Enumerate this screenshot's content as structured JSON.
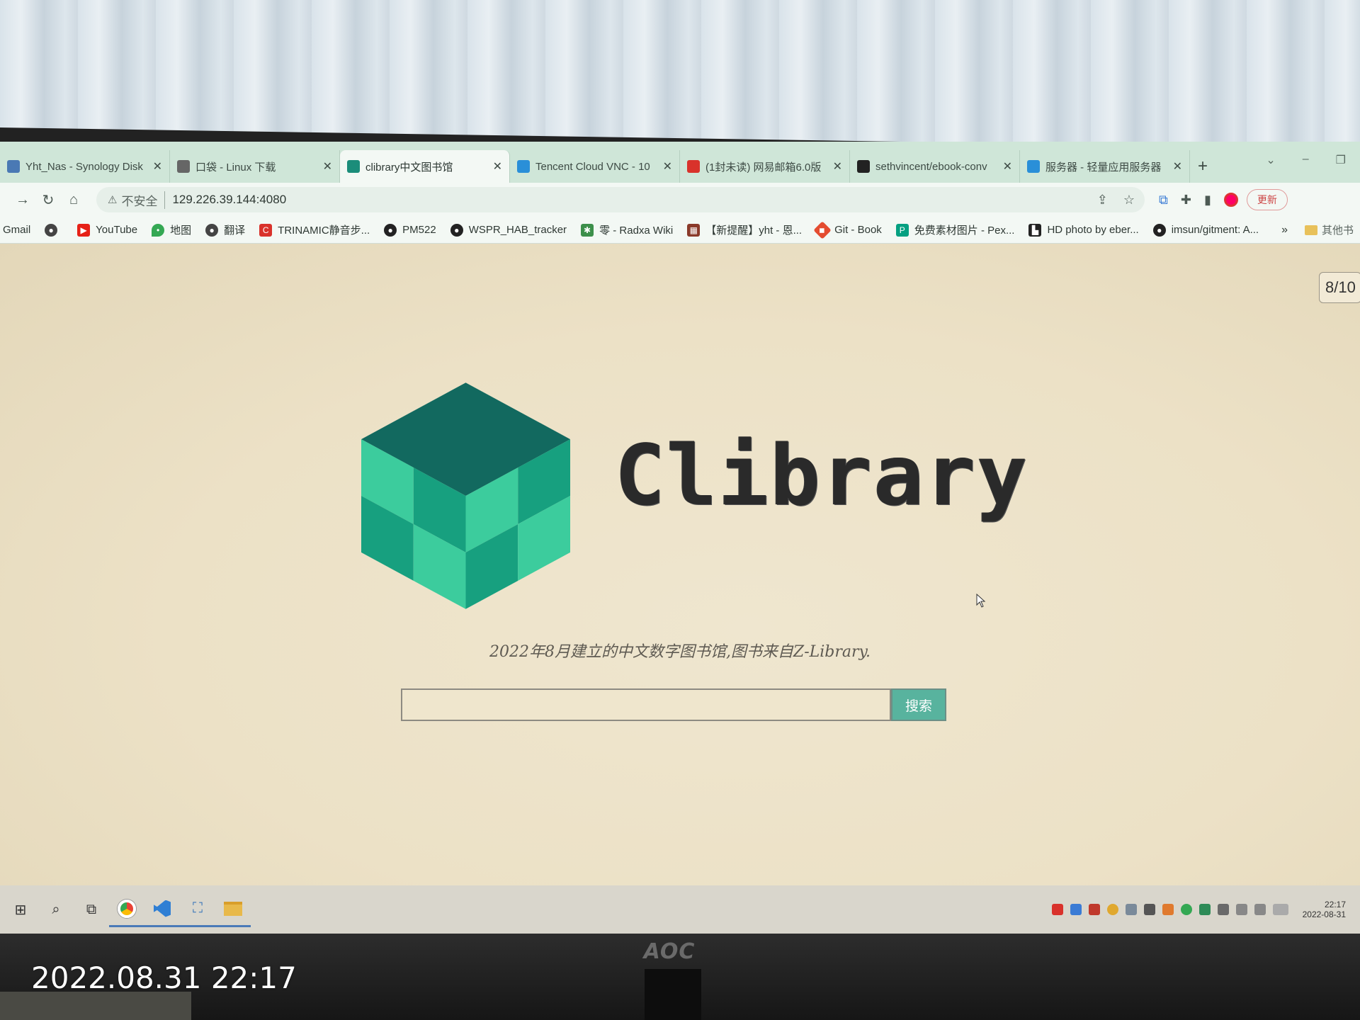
{
  "photo": {
    "timestamp": "2022.08.31 22:17",
    "monitor_brand": "AOC"
  },
  "browser": {
    "tabs": [
      {
        "label": "Yht_Nas - Synology Disk",
        "favicon": "synology-icon",
        "color": "#4a79b4"
      },
      {
        "label": "口袋 - Linux 下载",
        "favicon": "book-icon",
        "color": "#666666"
      },
      {
        "label": "clibrary中文图书馆",
        "favicon": "cube-icon",
        "color": "#1b8d7a",
        "active": true
      },
      {
        "label": "Tencent Cloud VNC - 10",
        "favicon": "cloud-icon",
        "color": "#2a8fd8"
      },
      {
        "label": "(1封未读) 网易邮箱6.0版",
        "favicon": "mail-icon",
        "color": "#d9322b"
      },
      {
        "label": "sethvincent/ebook-conv",
        "favicon": "github-icon",
        "color": "#222222"
      },
      {
        "label": "服务器 - 轻量应用服务器",
        "favicon": "cloud-icon",
        "color": "#2a8fd8"
      }
    ],
    "new_tab": "+",
    "address": {
      "security_label": "不安全",
      "url": "129.226.39.144:4080"
    },
    "update_label": "更新",
    "bookmarks": [
      {
        "label": "Gmail",
        "icon": "gmail-icon",
        "color": "transparent"
      },
      {
        "label": "",
        "icon": "globe-icon",
        "color": "#444444"
      },
      {
        "label": "YouTube",
        "icon": "youtube-icon",
        "color": "#e62117"
      },
      {
        "label": "地图",
        "icon": "maps-icon",
        "color": "#34a853"
      },
      {
        "label": "翻译",
        "icon": "globe-icon",
        "color": "#444444"
      },
      {
        "label": "TRINAMIC静音步...",
        "icon": "trinamic-icon",
        "color": "#d9322b"
      },
      {
        "label": "PM522",
        "icon": "github-icon",
        "color": "#222222"
      },
      {
        "label": "WSPR_HAB_tracker",
        "icon": "github-icon",
        "color": "#222222"
      },
      {
        "label": "零 - Radxa Wiki",
        "icon": "radxa-icon",
        "color": "#3c8f4a"
      },
      {
        "label": "【新提醒】yht - 恩...",
        "icon": "forum-icon",
        "color": "#8a3a2a"
      },
      {
        "label": "Git - Book",
        "icon": "git-icon",
        "color": "#e44c30"
      },
      {
        "label": "免费素材图片 - Pex...",
        "icon": "pexels-icon",
        "color": "#05a081"
      },
      {
        "label": "HD photo by eber...",
        "icon": "unsplash-icon",
        "color": "#222222"
      },
      {
        "label": "imsun/gitment: A...",
        "icon": "github-icon",
        "color": "#222222"
      }
    ],
    "bookmarks_more": "»",
    "other_bookmarks": "其他书"
  },
  "page": {
    "counter": "8/10",
    "brand": "Clibrary",
    "tagline": "2022年8月建立的中文数字图书馆,图书来自Z-Library.",
    "search": {
      "value": "",
      "placeholder": "",
      "button_label": "搜索"
    },
    "accent_color": "#1b8d7a"
  },
  "taskbar": {
    "time": "22:17",
    "date": "2022-08-31"
  }
}
